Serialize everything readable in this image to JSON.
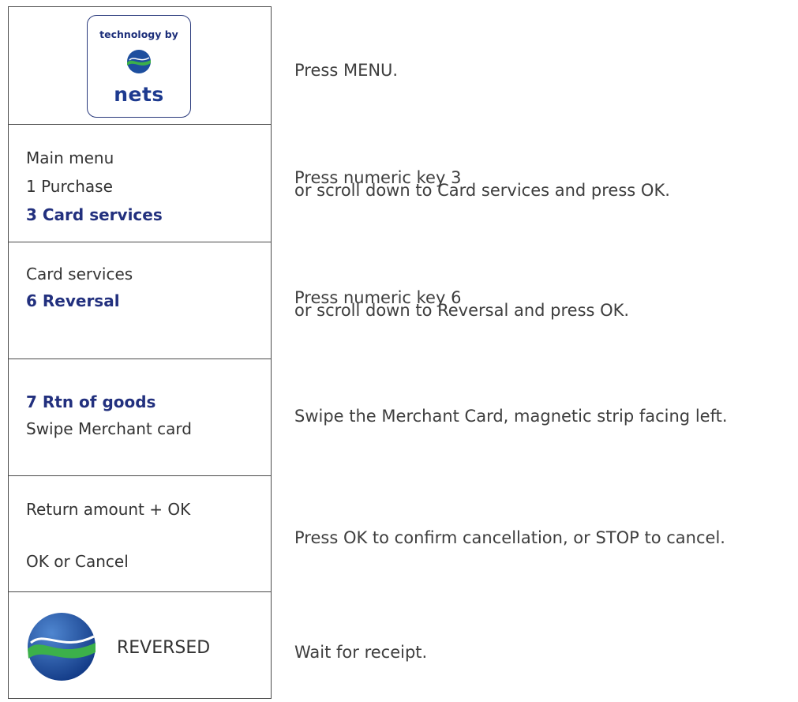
{
  "rows": [
    {
      "screen": {
        "logo_tagline": "technology by",
        "logo_brand": "nets"
      },
      "instruction": [
        "Press MENU."
      ]
    },
    {
      "screen": {
        "lines": [
          "Main menu",
          "1 Purchase",
          "3 Card services"
        ]
      },
      "instruction": [
        "Press numeric key 3",
        "or scroll down to Card services and press OK."
      ]
    },
    {
      "screen": {
        "lines": [
          "Card services",
          "6 Reversal"
        ]
      },
      "instruction": [
        "Press numeric key 6",
        "or scroll down to Reversal and press OK."
      ]
    },
    {
      "screen": {
        "lines": [
          "7 Rtn of goods",
          "Swipe Merchant card"
        ]
      },
      "instruction": [
        "Swipe the Merchant Card, magnetic strip facing left."
      ]
    },
    {
      "screen": {
        "lines": [
          "Return amount + OK",
          "OK or Cancel"
        ]
      },
      "instruction": [
        "Press OK to confirm cancellation, or STOP to cancel."
      ]
    },
    {
      "screen": {
        "status": "REVERSED",
        "icon": "nets-logo-icon"
      },
      "instruction": [
        "Wait for receipt."
      ]
    }
  ],
  "colors": {
    "highlight": "#22307e",
    "text": "#333333",
    "border": "#4a4a4a",
    "logo_blue": "#1d4e9e",
    "logo_green": "#3cb04a"
  }
}
